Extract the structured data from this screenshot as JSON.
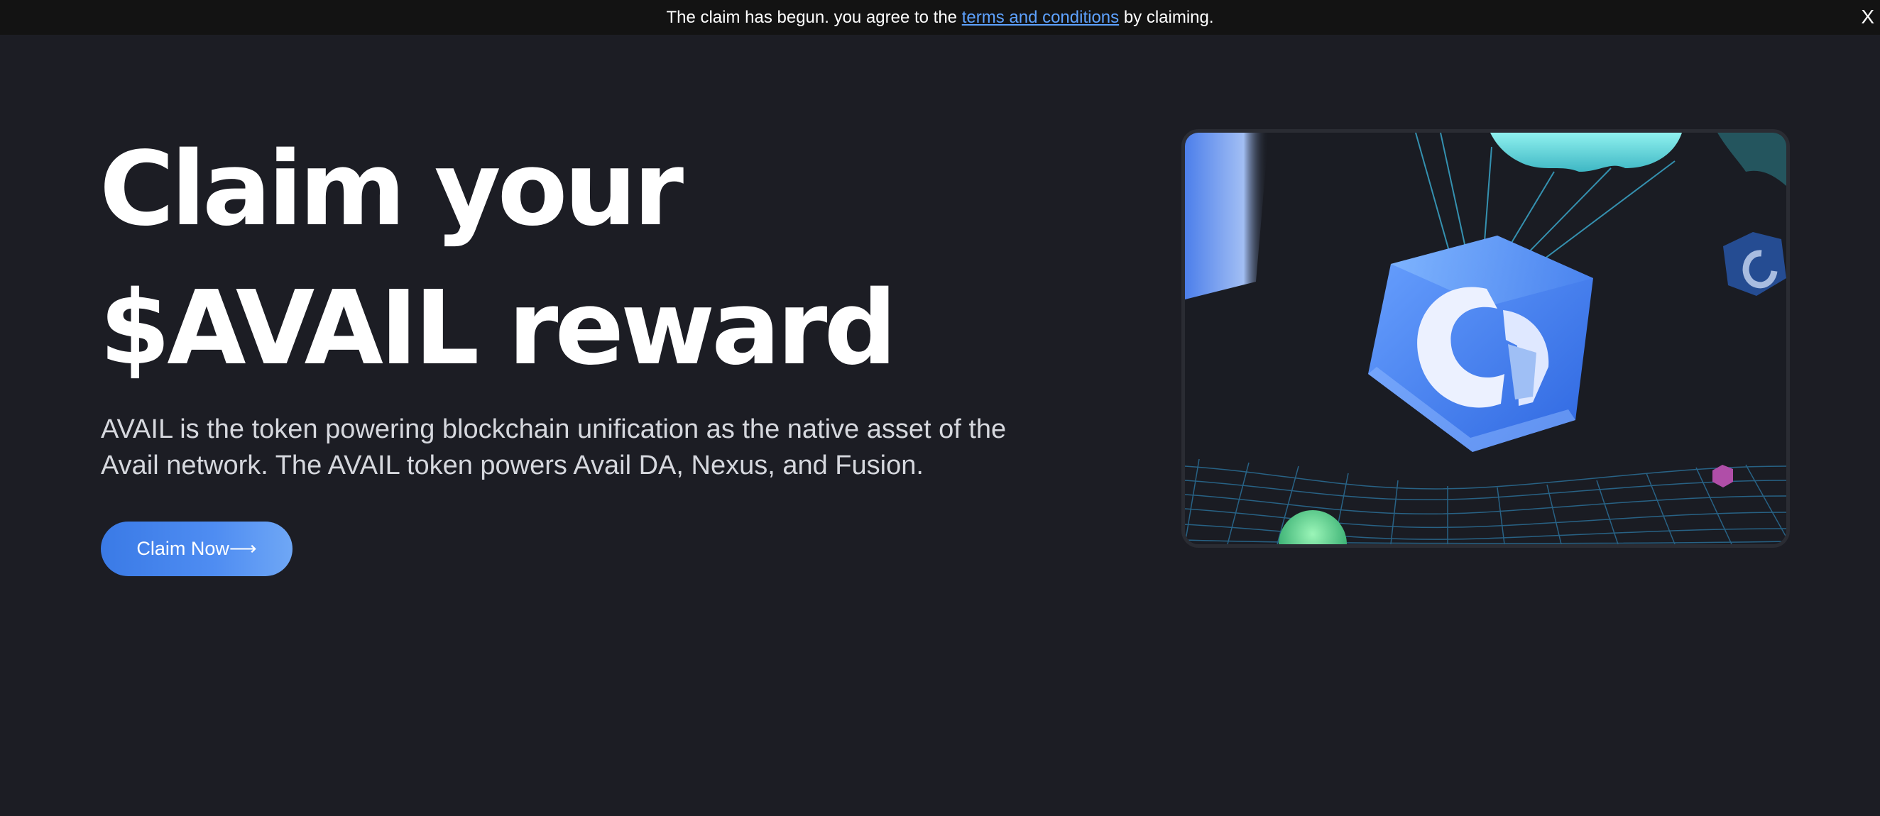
{
  "banner": {
    "text_before": "The claim has begun. you agree to the ",
    "link_text": "terms and conditions",
    "text_after": " by claiming.",
    "close_label": "X"
  },
  "hero": {
    "headline_line1": "Claim your",
    "headline_line2": "$AVAIL reward",
    "description": "AVAIL is the token powering blockchain unification as the native asset of the Avail network. The AVAIL token powers Avail DA, Nexus, and Fusion.",
    "cta_label": "Claim Now⟶"
  },
  "colors": {
    "background": "#1c1d24",
    "banner_background": "#131313",
    "link": "#5ea2ff",
    "accent": "#3a7ae6"
  },
  "icons": {
    "hero_illustration": "avail-token-cube-parachute-illustration"
  }
}
